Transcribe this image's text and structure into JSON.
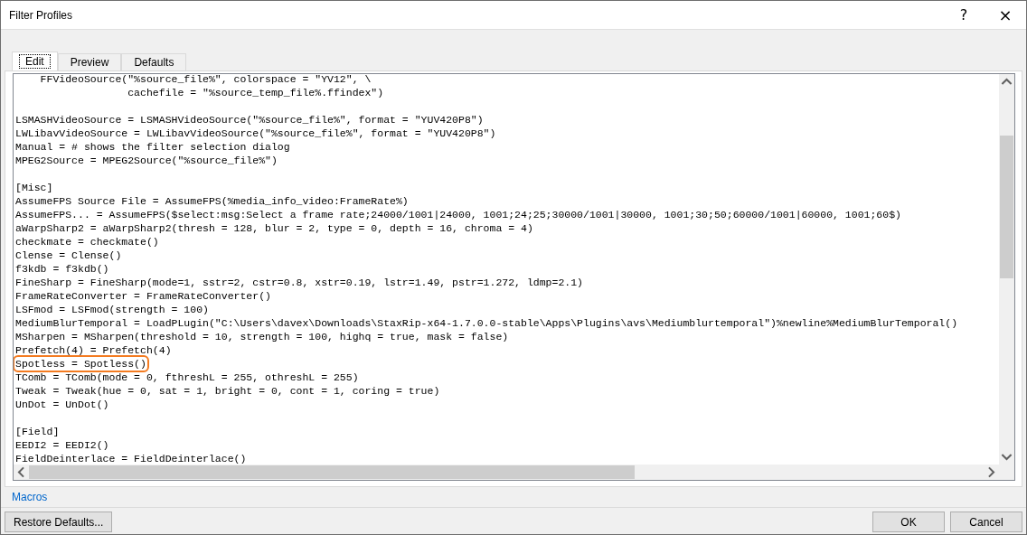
{
  "window": {
    "title": "Filter Profiles",
    "help": "?",
    "close": "×"
  },
  "tabs": [
    {
      "label": "Edit",
      "selected": true
    },
    {
      "label": "Preview",
      "selected": false
    },
    {
      "label": "Defaults",
      "selected": false
    }
  ],
  "editor": {
    "lines": [
      {
        "text": "    FFVideoSource(\"%source_file%\", colorspace = \"YV12\", \\",
        "highlighted": false
      },
      {
        "text": "                  cachefile = \"%source_temp_file%.ffindex\")",
        "highlighted": false
      },
      {
        "highlighted": false
      },
      {
        "text": "LSMASHVideoSource = LSMASHVideoSource(\"%source_file%\", format = \"YUV420P8\")",
        "highlighted": false
      },
      {
        "text": "LWLibavVideoSource = LWLibavVideoSource(\"%source_file%\", format = \"YUV420P8\")",
        "highlighted": false
      },
      {
        "text": "Manual = # shows the filter selection dialog",
        "highlighted": false
      },
      {
        "text": "MPEG2Source = MPEG2Source(\"%source_file%\")",
        "highlighted": false
      },
      {
        "highlighted": false
      },
      {
        "text": "[Misc]",
        "highlighted": false
      },
      {
        "text": "AssumeFPS Source File = AssumeFPS(%media_info_video:FrameRate%)",
        "highlighted": false
      },
      {
        "text": "AssumeFPS... = AssumeFPS($select:msg:Select a frame rate;24000/1001|24000, 1001;24;25;30000/1001|30000, 1001;30;50;60000/1001|60000, 1001;60$)",
        "highlighted": false
      },
      {
        "text": "aWarpSharp2 = aWarpSharp2(thresh = 128, blur = 2, type = 0, depth = 16, chroma = 4)",
        "highlighted": false
      },
      {
        "text": "checkmate = checkmate()",
        "highlighted": false
      },
      {
        "text": "Clense = Clense()",
        "highlighted": false
      },
      {
        "text": "f3kdb = f3kdb()",
        "highlighted": false
      },
      {
        "text": "FineSharp = FineSharp(mode=1, sstr=2, cstr=0.8, xstr=0.19, lstr=1.49, pstr=1.272, ldmp=2.1)",
        "highlighted": false
      },
      {
        "text": "FrameRateConverter = FrameRateConverter()",
        "highlighted": false
      },
      {
        "text": "LSFmod = LSFmod(strength = 100)",
        "highlighted": false
      },
      {
        "text": "MediumBlurTemporal = LoadPLugin(\"C:\\Users\\davex\\Downloads\\StaxRip-x64-1.7.0.0-stable\\Apps\\Plugins\\avs\\Mediumblurtemporal\")%newline%MediumBlurTemporal()",
        "highlighted": false
      },
      {
        "text": "MSharpen = MSharpen(threshold = 10, strength = 100, highq = true, mask = false)",
        "highlighted": false
      },
      {
        "text": "Prefetch(4) = Prefetch(4)",
        "highlighted": false
      },
      {
        "text": "Spotless = Spotless()",
        "highlighted": true
      },
      {
        "text": "TComb = TComb(mode = 0, fthreshL = 255, othreshL = 255)",
        "highlighted": false
      },
      {
        "text": "Tweak = Tweak(hue = 0, sat = 1, bright = 0, cont = 1, coring = true)",
        "highlighted": false
      },
      {
        "text": "UnDot = UnDot()",
        "highlighted": false
      },
      {
        "highlighted": false
      },
      {
        "text": "[Field]",
        "highlighted": false
      },
      {
        "text": "EEDI2 = EEDI2()",
        "highlighted": false
      },
      {
        "text": "FieldDeinterlace = FieldDeinterlace()",
        "highlighted": false
      }
    ]
  },
  "macros_link": "Macros",
  "buttons": {
    "restore": "Restore Defaults...",
    "ok": "OK",
    "cancel": "Cancel"
  }
}
